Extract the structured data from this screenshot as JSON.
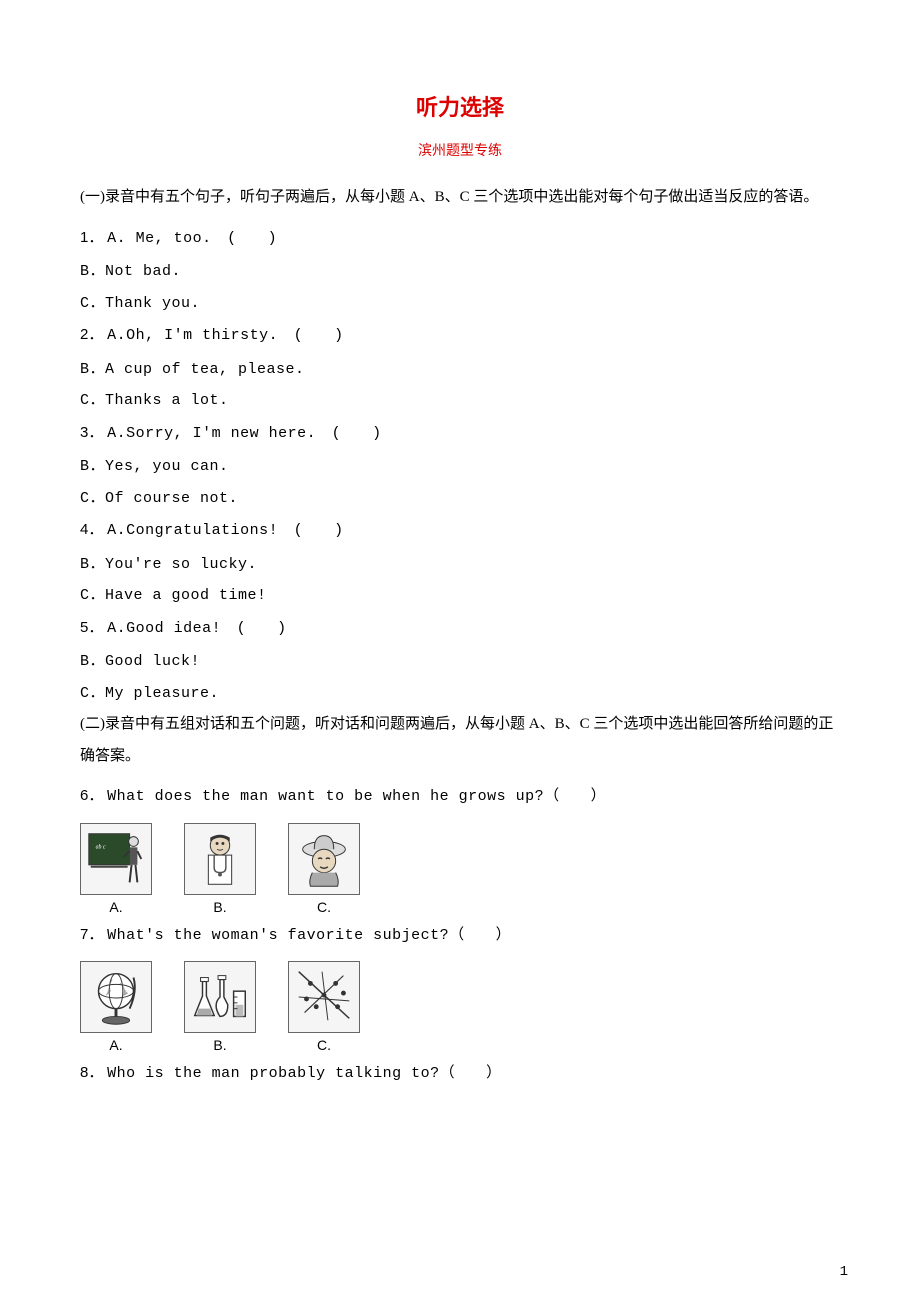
{
  "title": "听力选择",
  "subtitle": "滨州题型专练",
  "section1": {
    "intro": "(一)录音中有五个句子，听句子两遍后，从每小题 A、B、C 三个选项中选出能对每个句子做出适当反应的答语。",
    "questions": [
      {
        "num": "1．",
        "a": "A. Me, too.　(　　)",
        "b": "B．Not bad.",
        "c": "C．Thank you."
      },
      {
        "num": "2．",
        "a": "A.Oh, I'm thirsty.　(　　)",
        "b": "B．A cup of tea, please.",
        "c": "C．Thanks a lot."
      },
      {
        "num": "3．",
        "a": "A.Sorry, I'm new here.　(　　)",
        "b": "B．Yes, you can.",
        "c": "C．Of course not."
      },
      {
        "num": "4．",
        "a": "A.Congratulations!　(　　)",
        "b": "B．You're so lucky.",
        "c": "C．Have a good time!"
      },
      {
        "num": "5．",
        "a": "A.Good idea!　(　　)",
        "b": "B．Good luck!",
        "c": "C．My pleasure."
      }
    ]
  },
  "section2": {
    "intro": "(二)录音中有五组对话和五个问题，听对话和问题两遍后，从每小题 A、B、C 三个选项中选出能回答所给问题的正确答案。",
    "q6": {
      "num": "6．",
      "text": "What does the man want to be when he grows up?（　　）",
      "labels": {
        "a": "A.",
        "b": "B.",
        "c": "C."
      },
      "icons": {
        "a": "teacher-blackboard",
        "b": "doctor",
        "c": "farmer-hat"
      }
    },
    "q7": {
      "num": "7．",
      "text": "What's the woman's favorite subject?（　　）",
      "labels": {
        "a": "A.",
        "b": "B.",
        "c": "C."
      },
      "icons": {
        "a": "globe",
        "b": "flasks-chemistry",
        "c": "math-graph"
      }
    },
    "q8": {
      "num": "8．",
      "text": "Who is the man probably talking to?（　　）"
    }
  },
  "pageNumber": "1"
}
